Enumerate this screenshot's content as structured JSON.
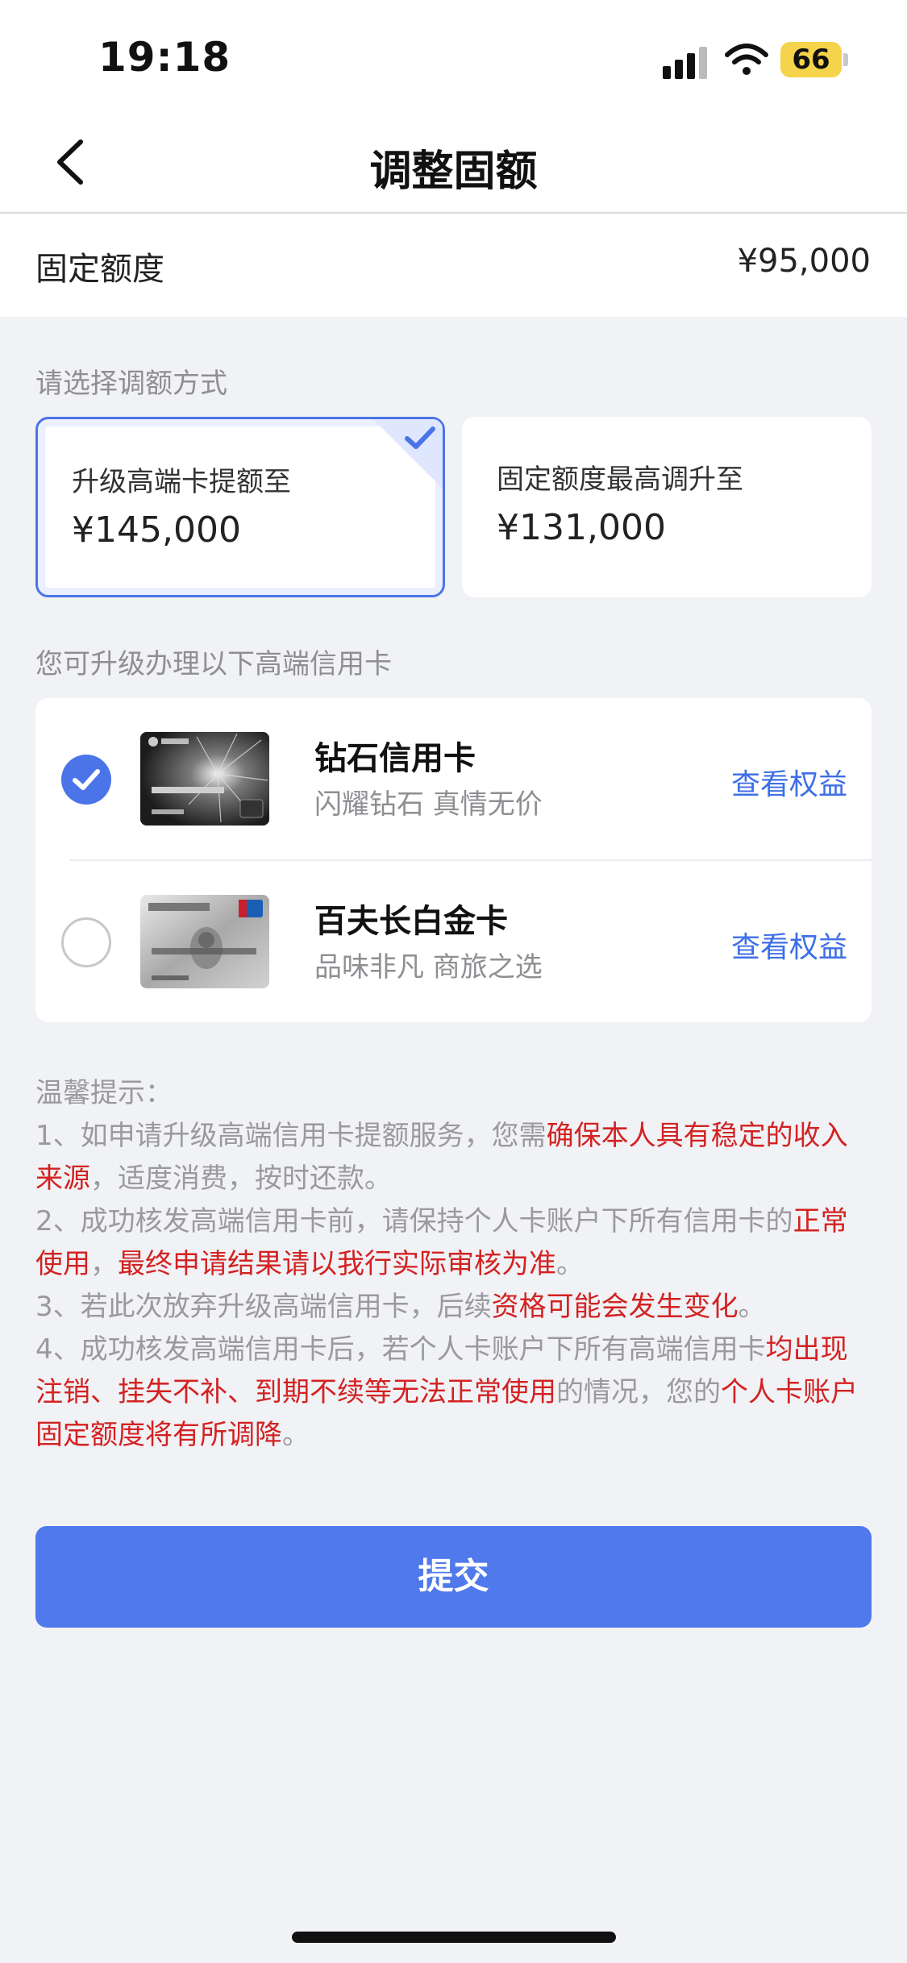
{
  "status_bar": {
    "time": "19:18",
    "battery": "66"
  },
  "nav": {
    "title": "调整固额"
  },
  "fixed_quota": {
    "label": "固定额度",
    "value": "¥95,000"
  },
  "method_section": {
    "label": "请选择调额方式",
    "options": [
      {
        "title": "升级高端卡提额至",
        "amount": "¥145,000",
        "selected": true
      },
      {
        "title": "固定额度最高调升至",
        "amount": "¥131,000",
        "selected": false
      }
    ]
  },
  "cards_section": {
    "label": "您可升级办理以下高端信用卡",
    "cards": [
      {
        "name": "钻石信用卡",
        "desc": "闪耀钻石 真情无价",
        "link": "查看权益",
        "selected": true
      },
      {
        "name": "百夫长白金卡",
        "desc": "品味非凡 商旅之选",
        "link": "查看权益",
        "selected": false
      }
    ]
  },
  "tips": {
    "title": "温馨提示：",
    "items": [
      [
        "1、如申请升级高端信用卡提额服务，您需",
        "确保本人具有稳定的收入来源",
        "，适度消费，按时还款。"
      ],
      [
        "2、成功核发高端信用卡前，请保持个人卡账户下所有信用卡的",
        "正常使用",
        "，",
        "最终申请结果请以我行实际审核为准",
        "。"
      ],
      [
        "3、若此次放弃升级高端信用卡，后续",
        "资格可能会发生变化",
        "。"
      ],
      [
        "4、成功核发高端信用卡后，若个人卡账户下所有高端信用卡",
        "均出现注销、挂失不补、到期不续等无法正常使用",
        "的情况，您的",
        "个人卡账户固定额度将有所调降",
        "。"
      ]
    ]
  },
  "submit": {
    "label": "提交"
  },
  "colors": {
    "accent": "#4b74e8",
    "warning": "#d32222",
    "link": "#3d6fe6"
  }
}
